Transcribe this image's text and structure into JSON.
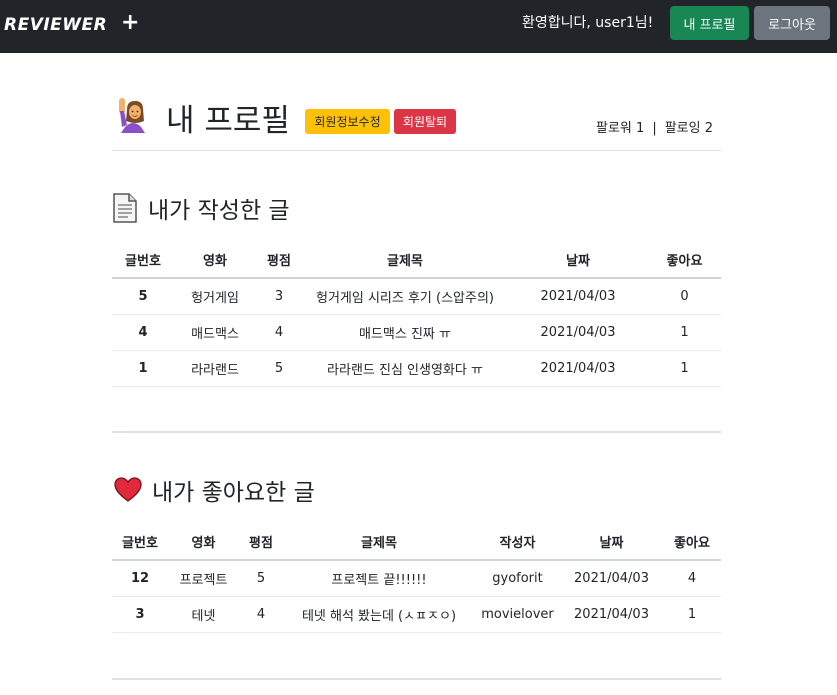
{
  "navbar": {
    "brand": "REVIEWER",
    "plus_label": "+",
    "welcome": "환영합니다, user1님!",
    "profile_button": "내 프로필",
    "logout_button": "로그아웃"
  },
  "profile": {
    "title": "내 프로필",
    "edit_badge": "회원정보수정",
    "delete_badge": "회원탈퇴",
    "followers": "팔로워 1",
    "separator": "|",
    "following": "팔로잉 2"
  },
  "my_posts": {
    "title": "내가 작성한 글",
    "headers": [
      "글번호",
      "영화",
      "평점",
      "글제목",
      "날짜",
      "좋아요"
    ],
    "rows": [
      [
        "5",
        "헝거게임",
        "3",
        "헝거게임 시리즈 후기 (스압주의)",
        "2021/04/03",
        "0"
      ],
      [
        "4",
        "매드맥스",
        "4",
        "매드맥스 진짜 ㅠ",
        "2021/04/03",
        "1"
      ],
      [
        "1",
        "라라랜드",
        "5",
        "라라랜드 진심 인생영화다 ㅠ",
        "2021/04/03",
        "1"
      ]
    ]
  },
  "liked_posts": {
    "title": "내가 좋아요한 글",
    "headers": [
      "글번호",
      "영화",
      "평점",
      "글제목",
      "작성자",
      "날짜",
      "좋아요"
    ],
    "rows": [
      [
        "12",
        "프로젝트",
        "5",
        "프로젝트 끝!!!!!!",
        "gyoforit",
        "2021/04/03",
        "4"
      ],
      [
        "3",
        "테넷",
        "4",
        "테넷 해석 봤는데 (ㅅㅍㅈㅇ)",
        "movielover",
        "2021/04/03",
        "1"
      ]
    ]
  }
}
